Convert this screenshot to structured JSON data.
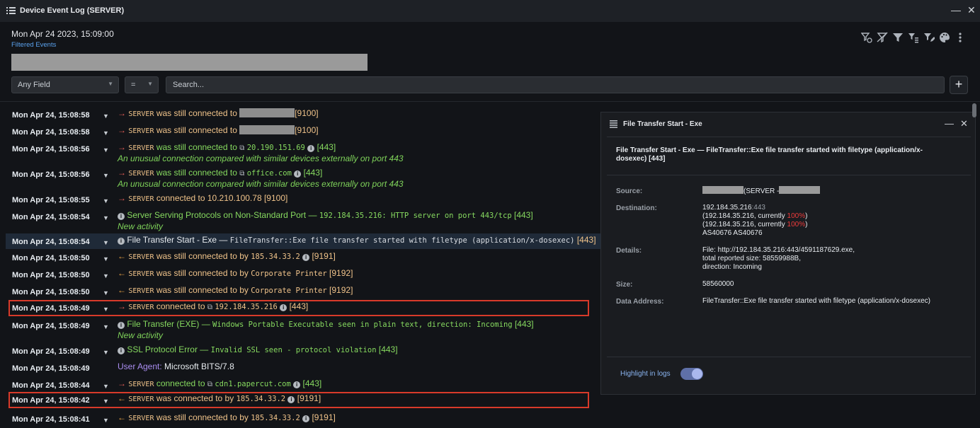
{
  "window": {
    "title": "Device Event Log (SERVER)",
    "minimize_glyph": "—",
    "close_glyph": "✕"
  },
  "header": {
    "date": "Mon Apr 24 2023, 15:09:00",
    "filtered_label": "Filtered Events"
  },
  "toolbar": {
    "icons": [
      "filter-add-icon",
      "filter-clear-icon",
      "filter-icon",
      "filter-list-icon",
      "filter-edit-icon",
      "palette-icon",
      "more-vertical-icon"
    ]
  },
  "search": {
    "field_select": "Any Field",
    "operator_select": "=",
    "placeholder": "Search...",
    "add_label": "+"
  },
  "log": {
    "rows": [
      {
        "ts": "Mon Apr 24, 15:08:58",
        "dir": "→",
        "dev": "SERVER",
        "verb": "was still connected to",
        "port": "[9100]"
      },
      {
        "ts": "Mon Apr 24, 15:08:58",
        "dir": "→",
        "dev": "SERVER",
        "verb": "was still connected to",
        "port": "[9100]"
      },
      {
        "ts": "Mon Apr 24, 15:08:56",
        "dir": "→",
        "dev": "SERVER",
        "verb": "was still connected to",
        "target": "20.190.151.69",
        "port": "[443]",
        "sub": "An unusual connection compared with similar devices externally on port 443"
      },
      {
        "ts": "Mon Apr 24, 15:08:56",
        "dir": "→",
        "dev": "SERVER",
        "verb": "was still connected to",
        "target": "office.com",
        "port": "[443]",
        "sub": "An unusual connection compared with similar devices externally on port 443"
      },
      {
        "ts": "Mon Apr 24, 15:08:55",
        "dir": "→",
        "dev": "SERVER",
        "verb": "connected to",
        "target": "10.210.100.78",
        "port": "[9100]"
      },
      {
        "ts": "Mon Apr 24, 15:08:54",
        "title": "Server Serving Protocols on Non-Standard Port —",
        "detail": "192.184.35.216: HTTP server on port 443/tcp",
        "port": "[443]",
        "sub": "New activity"
      },
      {
        "ts": "Mon Apr 24, 15:08:54",
        "title": "File Transfer Start - Exe —",
        "detail": "FileTransfer::Exe file transfer started with filetype (application/x-dosexec)",
        "port": "[443]"
      },
      {
        "ts": "Mon Apr 24, 15:08:50",
        "dir": "←",
        "dev": "SERVER",
        "verb": "was still connected to by",
        "target": "185.34.33.2",
        "port": "[9191]"
      },
      {
        "ts": "Mon Apr 24, 15:08:50",
        "dir": "←",
        "dev": "SERVER",
        "verb": "was still connected to by",
        "target": "Corporate Printer",
        "port": "[9192]"
      },
      {
        "ts": "Mon Apr 24, 15:08:50",
        "dir": "←",
        "dev": "SERVER",
        "verb": "was still connected to by",
        "target": "Corporate Printer",
        "port": "[9192]"
      },
      {
        "ts": "Mon Apr 24, 15:08:49",
        "dir": "→",
        "dev": "SERVER",
        "verb": "connected to",
        "target": "192.184.35.216",
        "port": "[443]"
      },
      {
        "ts": "Mon Apr 24, 15:08:49",
        "title": "File Transfer (EXE) —",
        "detail": "Windows Portable Executable seen in plain text, direction: Incoming",
        "port": "[443]",
        "sub": "New activity"
      },
      {
        "ts": "Mon Apr 24, 15:08:49",
        "title": "SSL Protocol Error —",
        "detail": "Invalid SSL seen - protocol violation",
        "port": "[443]"
      },
      {
        "ts": "Mon Apr 24, 15:08:49",
        "ua_label": "User Agent:",
        "ua_value": "Microsoft BITS/7.8"
      },
      {
        "ts": "Mon Apr 24, 15:08:44",
        "dir": "→",
        "dev": "SERVER",
        "verb": "connected to",
        "target": "cdn1.papercut.com",
        "port": "[443]"
      },
      {
        "ts": "Mon Apr 24, 15:08:42",
        "dir": "←",
        "dev": "SERVER",
        "verb": "was connected to by",
        "target": "185.34.33.2",
        "port": "[9191]"
      },
      {
        "ts": "Mon Apr 24, 15:08:41",
        "dir": "←",
        "dev": "SERVER",
        "verb": "was still connected to by",
        "target": "185.34.33.2",
        "port": "[9191]"
      }
    ]
  },
  "panel": {
    "title": "File Transfer Start - Exe",
    "summary": "File Transfer Start - Exe — FileTransfer::Exe file transfer started with filetype (application/x-dosexec) [443]",
    "source_label": "Source:",
    "source_value": "(SERVER -",
    "destination_label": "Destination:",
    "dest_ip": "192.184.35.216",
    "dest_port": ":443",
    "dest_line2_pre": "(192.184.35.216, currently ",
    "dest_pct": "100%",
    "dest_line_post": ")",
    "dest_line3_pre": "(192.184.35.216, currently ",
    "dest_asn": "AS40676 AS40676",
    "details_label": "Details:",
    "details_line1": "File: http://192.184.35.216:443/4591187629.exe,",
    "details_line2": "total reported size: 58559988B,",
    "details_line3": "direction: Incoming",
    "size_label": "Size:",
    "size_value": "58560000",
    "data_address_label": "Data Address:",
    "data_address_value": "FileTransfer::Exe file transfer started with filetype (application/x-dosexec)",
    "highlight_label": "Highlight in logs",
    "highlight_on": true
  },
  "colors": {
    "highlight_outline": "#d83a2a",
    "accent_blue": "#5aa2ee",
    "green_text": "#86d95f",
    "amber_text": "#f0c38a"
  }
}
